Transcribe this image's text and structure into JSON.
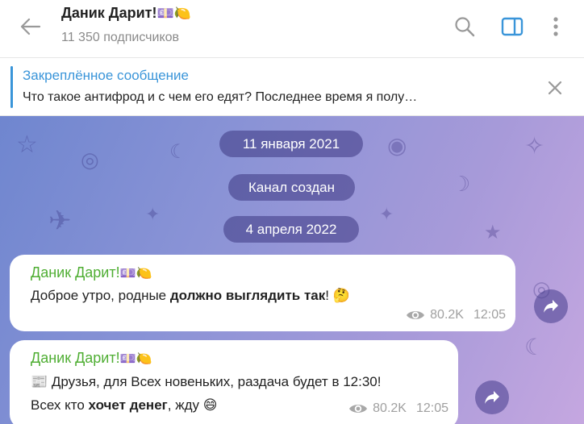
{
  "header": {
    "title": "Даник Дарит!",
    "title_emoji": "💷🍋",
    "subscribers": "11 350 подписчиков",
    "icons": [
      "back-arrow-icon",
      "search-icon",
      "sidebar-toggle-icon",
      "more-vert-icon"
    ]
  },
  "pinned": {
    "title": "Закреплённое сообщение",
    "text": "Что такое антифрод и с чем его едят?  Последнее время я полу…"
  },
  "chat": {
    "date1": "11 января 2021",
    "service": "Канал создан",
    "date2": "4 апреля 2022",
    "messages": [
      {
        "author": "Даник Дарит!",
        "author_emoji": "💷🍋",
        "pre": "Доброе утро, родные ",
        "bold": "должно выглядить так",
        "post": "! ",
        "emoji": "🤔",
        "views": "80.2K",
        "time": "12:05"
      },
      {
        "author": "Даник Дарит!",
        "author_emoji": "💷🍋",
        "icon": "📰",
        "line1": " Друзья, для Всех новеньких, раздача будет в 12:30!",
        "line2_pre": "Всех кто ",
        "line2_bold": "хочет денег",
        "line2_post": ", жду ",
        "emoji": "😄",
        "views": "80.2K",
        "time": "12:05"
      }
    ]
  },
  "colors": {
    "accent": "#3a95d9",
    "author": "#4fae33"
  }
}
